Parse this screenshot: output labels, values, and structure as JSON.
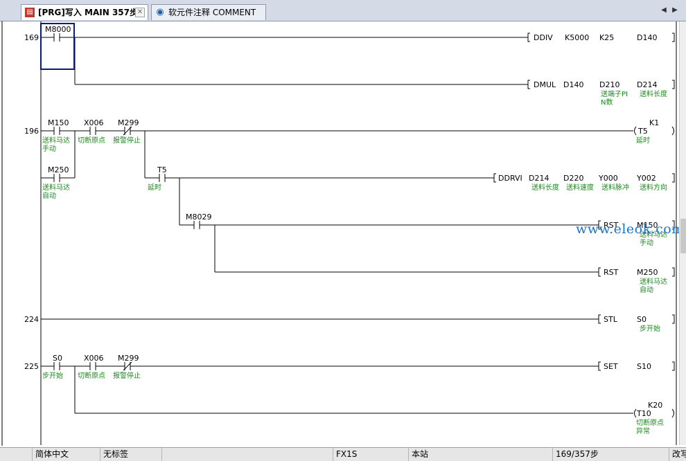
{
  "tabs": [
    {
      "label": "[PRG]写入 MAIN 357步",
      "icon": "ladder-program-icon",
      "active": true
    },
    {
      "label": "软元件注释 COMMENT",
      "icon": "device-comment-icon",
      "active": false
    }
  ],
  "tab_close": "✕",
  "nav": {
    "left": "◀",
    "right": "▶"
  },
  "ladder": {
    "rungs": [
      {
        "step": "169",
        "contacts": [
          {
            "device": "M8000",
            "type": "NO"
          }
        ],
        "outputs": [
          {
            "instr": "DDIV",
            "operands": [
              "K5000",
              "K25",
              "D140"
            ],
            "comments": [
              "",
              "",
              ""
            ]
          },
          {
            "instr": "DMUL",
            "operands": [
              "D140",
              "D210",
              "D214"
            ],
            "comments": [
              "",
              "送端子PIN数",
              "送料长度"
            ]
          }
        ]
      },
      {
        "step": "196",
        "contacts": [
          {
            "device": "M150",
            "type": "NO",
            "comment": "送料马达手动"
          },
          {
            "device": "X006",
            "type": "NO",
            "comment": "切断原点"
          },
          {
            "device": "M299",
            "type": "NC",
            "comment": "报警停止"
          },
          {
            "device": "M250",
            "type": "NO",
            "comment": "送料马达自动"
          },
          {
            "device": "T5",
            "type": "NO",
            "comment": "延时"
          },
          {
            "device": "M8029",
            "type": "NO",
            "comment": ""
          }
        ],
        "outputs": [
          {
            "instr": "OUT",
            "device": "T5",
            "setting": "K1",
            "comment": "延时"
          },
          {
            "instr": "DDRVI",
            "operands": [
              "D214",
              "D220",
              "Y000",
              "Y002"
            ],
            "comments": [
              "送料长度",
              "送料速度",
              "送料脉冲",
              "送料方向"
            ]
          },
          {
            "instr": "RST",
            "operands": [
              "M150"
            ],
            "comments": [
              "送料马达手动"
            ]
          },
          {
            "instr": "RST",
            "operands": [
              "M250"
            ],
            "comments": [
              "送料马达自动"
            ]
          }
        ]
      },
      {
        "step": "224",
        "contacts": [],
        "outputs": [
          {
            "instr": "STL",
            "operands": [
              "S0"
            ],
            "comments": [
              "步开始"
            ]
          }
        ]
      },
      {
        "step": "225",
        "contacts": [
          {
            "device": "S0",
            "type": "NO",
            "comment": "步开始"
          },
          {
            "device": "X006",
            "type": "NO",
            "comment": "切断原点"
          },
          {
            "device": "M299",
            "type": "NC",
            "comment": "报警停止"
          }
        ],
        "outputs": [
          {
            "instr": "SET",
            "operands": [
              "S10"
            ],
            "comments": [
              ""
            ]
          },
          {
            "instr": "OUT",
            "device": "T10",
            "setting": "K20",
            "comment": "切断原点异常"
          }
        ]
      }
    ]
  },
  "watermark": "www.eleok.com",
  "status": {
    "language": "简体中文",
    "label": "无标签",
    "plc": "FX1S",
    "station": "本站",
    "step": "169/357步",
    "mode": "改写"
  },
  "colors": {
    "comment_text": "#1b8a1b",
    "cursor": "#0a1a7a",
    "watermark": "#1e73c9"
  }
}
